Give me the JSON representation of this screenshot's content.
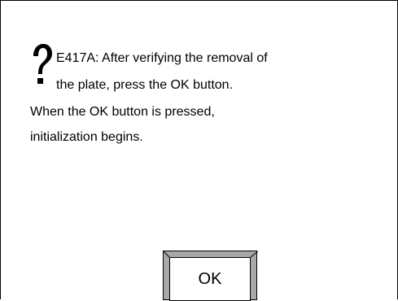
{
  "dialog": {
    "icon": "question-mark-icon",
    "message_lines": [
      "E417A: After verifying the removal of",
      "the plate, press the OK button.",
      "When the OK button is pressed,",
      "initialization begins."
    ],
    "ok_label": "OK"
  }
}
